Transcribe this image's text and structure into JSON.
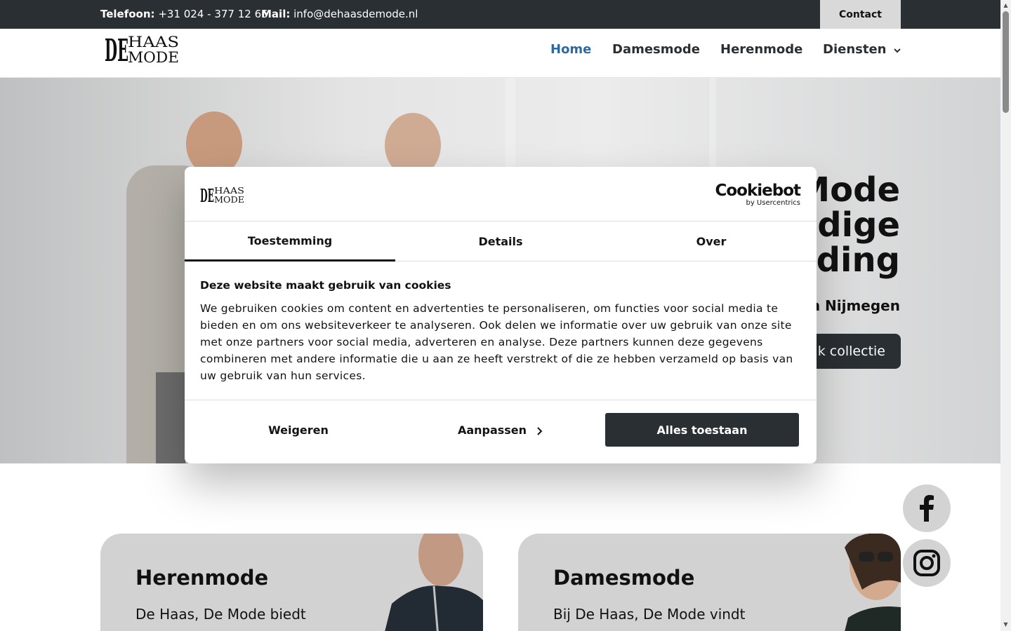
{
  "topbar": {
    "phone_label": "Telefoon:",
    "phone_value": "+31 024 - 377 12 66",
    "mail_label": "Mail:",
    "mail_value": "info@dehaasdemode.nl",
    "contact_label": "Contact"
  },
  "header": {
    "logo_text": "DE HAAS MODE",
    "nav": [
      {
        "label": "Home",
        "active": true
      },
      {
        "label": "Damesmode"
      },
      {
        "label": "Herenmode"
      },
      {
        "label": "Diensten"
      }
    ]
  },
  "hero": {
    "title_lines": [
      "Mode",
      "dige",
      "ding"
    ],
    "subtitle": "n Nijmegen",
    "button_label": "jk collectie"
  },
  "cards": [
    {
      "title": "Herenmode",
      "text": "De Haas, De Mode biedt"
    },
    {
      "title": "Damesmode",
      "text": "Bij De Haas, De Mode vindt"
    }
  ],
  "social": {
    "facebook": "facebook-icon",
    "instagram": "instagram-icon"
  },
  "cookie_dialog": {
    "brand": "Cookiebot",
    "brand_sub": "by Usercentrics",
    "tabs": [
      "Toestemming",
      "Details",
      "Over"
    ],
    "heading": "Deze website maakt gebruik van cookies",
    "body": "We gebruiken cookies om content en advertenties te personaliseren, om functies voor social media te bieden en om ons websiteverkeer te analyseren. Ook delen we informatie over uw gebruik van onze site met onze partners voor social media, adverteren en analyse. Deze partners kunnen deze gegevens combineren met andere informatie die u aan ze heeft verstrekt of die ze hebben verzameld op basis van uw gebruik van hun services.",
    "buttons": {
      "deny": "Weigeren",
      "customize": "Aanpassen",
      "allow_all": "Alles toestaan"
    }
  },
  "colors": {
    "dark": "#2a2f33",
    "active_nav": "#2e6aa0",
    "card_bg": "#d2d2d2"
  }
}
